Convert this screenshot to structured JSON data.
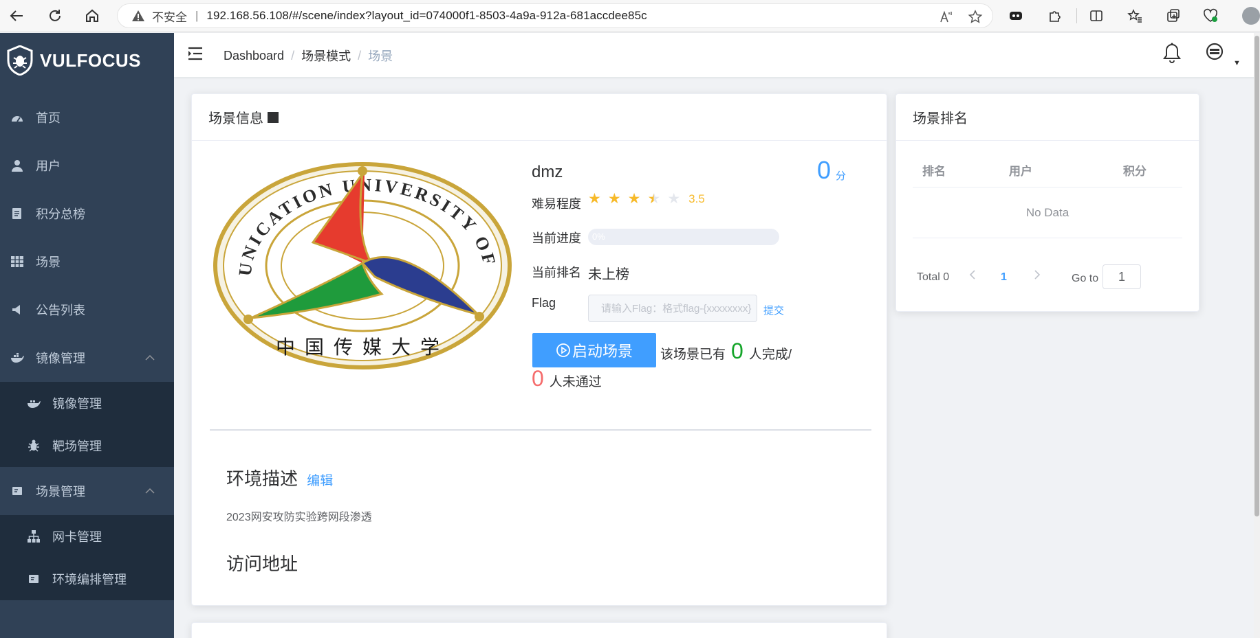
{
  "browser": {
    "insecure_label": "不安全",
    "url": "192.168.56.108/#/scene/index?layout_id=074000f1-8503-4a9a-912a-681accdee85c"
  },
  "sidebar": {
    "brand": "VULFOCUS",
    "items": [
      {
        "label": "首页",
        "icon": "dashboard-icon"
      },
      {
        "label": "用户",
        "icon": "user-icon"
      },
      {
        "label": "积分总榜",
        "icon": "ranking-doc-icon"
      },
      {
        "label": "场景",
        "icon": "grid-icon"
      },
      {
        "label": "公告列表",
        "icon": "megaphone-icon"
      },
      {
        "label": "镜像管理",
        "icon": "docker-icon",
        "expanded": true
      },
      {
        "label": "场景管理",
        "icon": "scene-icon",
        "expanded": true
      }
    ],
    "image_submenu": [
      {
        "label": "镜像管理",
        "icon": "docker-icon"
      },
      {
        "label": "靶场管理",
        "icon": "bug-icon"
      }
    ],
    "scene_submenu": [
      {
        "label": "网卡管理",
        "icon": "network-icon"
      },
      {
        "label": "环境编排管理",
        "icon": "layout-icon"
      }
    ]
  },
  "header": {
    "breadcrumb": [
      "Dashboard",
      "场景模式",
      "场景"
    ]
  },
  "scene_card": {
    "title": "场景信息",
    "name": "dmz",
    "score": "0",
    "score_unit": "分",
    "difficulty_label": "难易程度",
    "rating": 3.5,
    "rating_text": "3.5",
    "progress_label": "当前进度",
    "progress_percent": 0,
    "progress_text": "0%",
    "rank_label": "当前排名",
    "rank_value": "未上榜",
    "flag_label": "Flag",
    "flag_placeholder": "请输入Flag：格式flag-{xxxxxxxx}",
    "submit_label": "提交",
    "start_button": "启动场景",
    "completed_prefix": "该场景已有",
    "completed_count": "0",
    "completed_suffix": "人完成/",
    "failed_count": "0",
    "failed_suffix": "人未通过",
    "env_desc_title": "环境描述",
    "edit_label": "编辑",
    "env_desc": "2023网安攻防实验跨网段渗透",
    "access_title": "访问地址",
    "logo": {
      "top_text": "COMMUNICATION UNIVERSITY OF CHINA",
      "bottom_text": "中国传媒大学"
    }
  },
  "ranking_card": {
    "title": "场景排名",
    "columns": [
      "排名",
      "用户",
      "积分"
    ],
    "empty_text": "No Data",
    "total_text": "Total 0",
    "page": "1",
    "goto_label": "Go to",
    "goto_value": "1"
  },
  "colors": {
    "sidebar_bg": "#304156",
    "submenu_bg": "#1f2d3d",
    "primary": "#409eff",
    "star": "#f7ba2a",
    "success": "#15a52a",
    "danger": "#f56c6c"
  }
}
